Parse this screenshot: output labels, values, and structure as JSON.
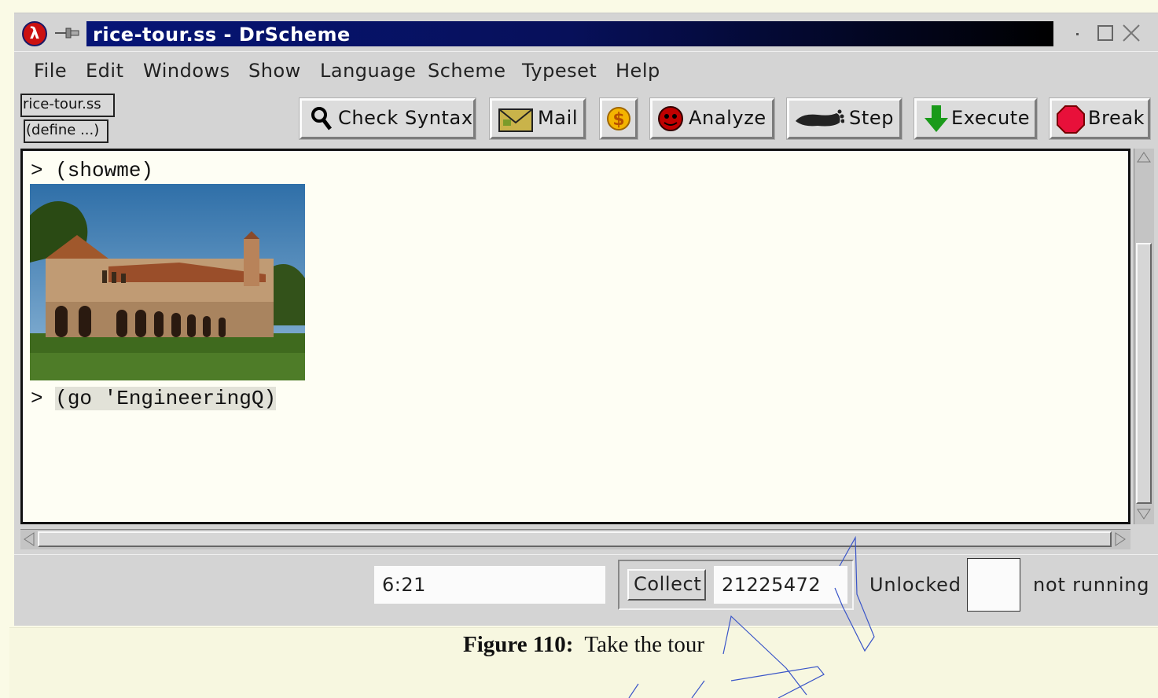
{
  "window": {
    "title": "rice-tour.ss - DrScheme",
    "controls": [
      "minimize-icon",
      "maximize-icon",
      "close-icon"
    ]
  },
  "menubar": {
    "items": [
      "File",
      "Edit",
      "Windows",
      "Show",
      "Language",
      "Scheme",
      "Typeset",
      "Help"
    ]
  },
  "toolbar": {
    "file_button": "rice-tour.ss",
    "define_button": "(define ...)",
    "check_syntax": "Check Syntax",
    "mail": "Mail",
    "analyze": "Analyze",
    "step": "Step",
    "execute": "Execute",
    "break": "Break",
    "icons": {
      "check_syntax": "magnifier-icon",
      "mail": "envelope-icon",
      "dollar": "dollar-icon",
      "analyze": "spider-icon",
      "step": "foot-icon",
      "execute": "down-arrow-icon",
      "break": "stop-sign-icon"
    }
  },
  "interactions": {
    "line1": "> (showme)",
    "line2_prompt": "> ",
    "line2_expr": "(go 'EngineeringQ)"
  },
  "status": {
    "position": "6:21",
    "collect": "Collect",
    "memory": "21225472",
    "lock": "Unlocked",
    "running": "not running"
  },
  "caption": {
    "label": "Figure 110:",
    "text": "Take the tour"
  },
  "colors": {
    "title_gradient_start": "#061577",
    "title_gradient_end": "#000000",
    "window_bg": "#d4d4d4",
    "editor_bg": "#fefef4",
    "page_bg": "#fafae6"
  }
}
